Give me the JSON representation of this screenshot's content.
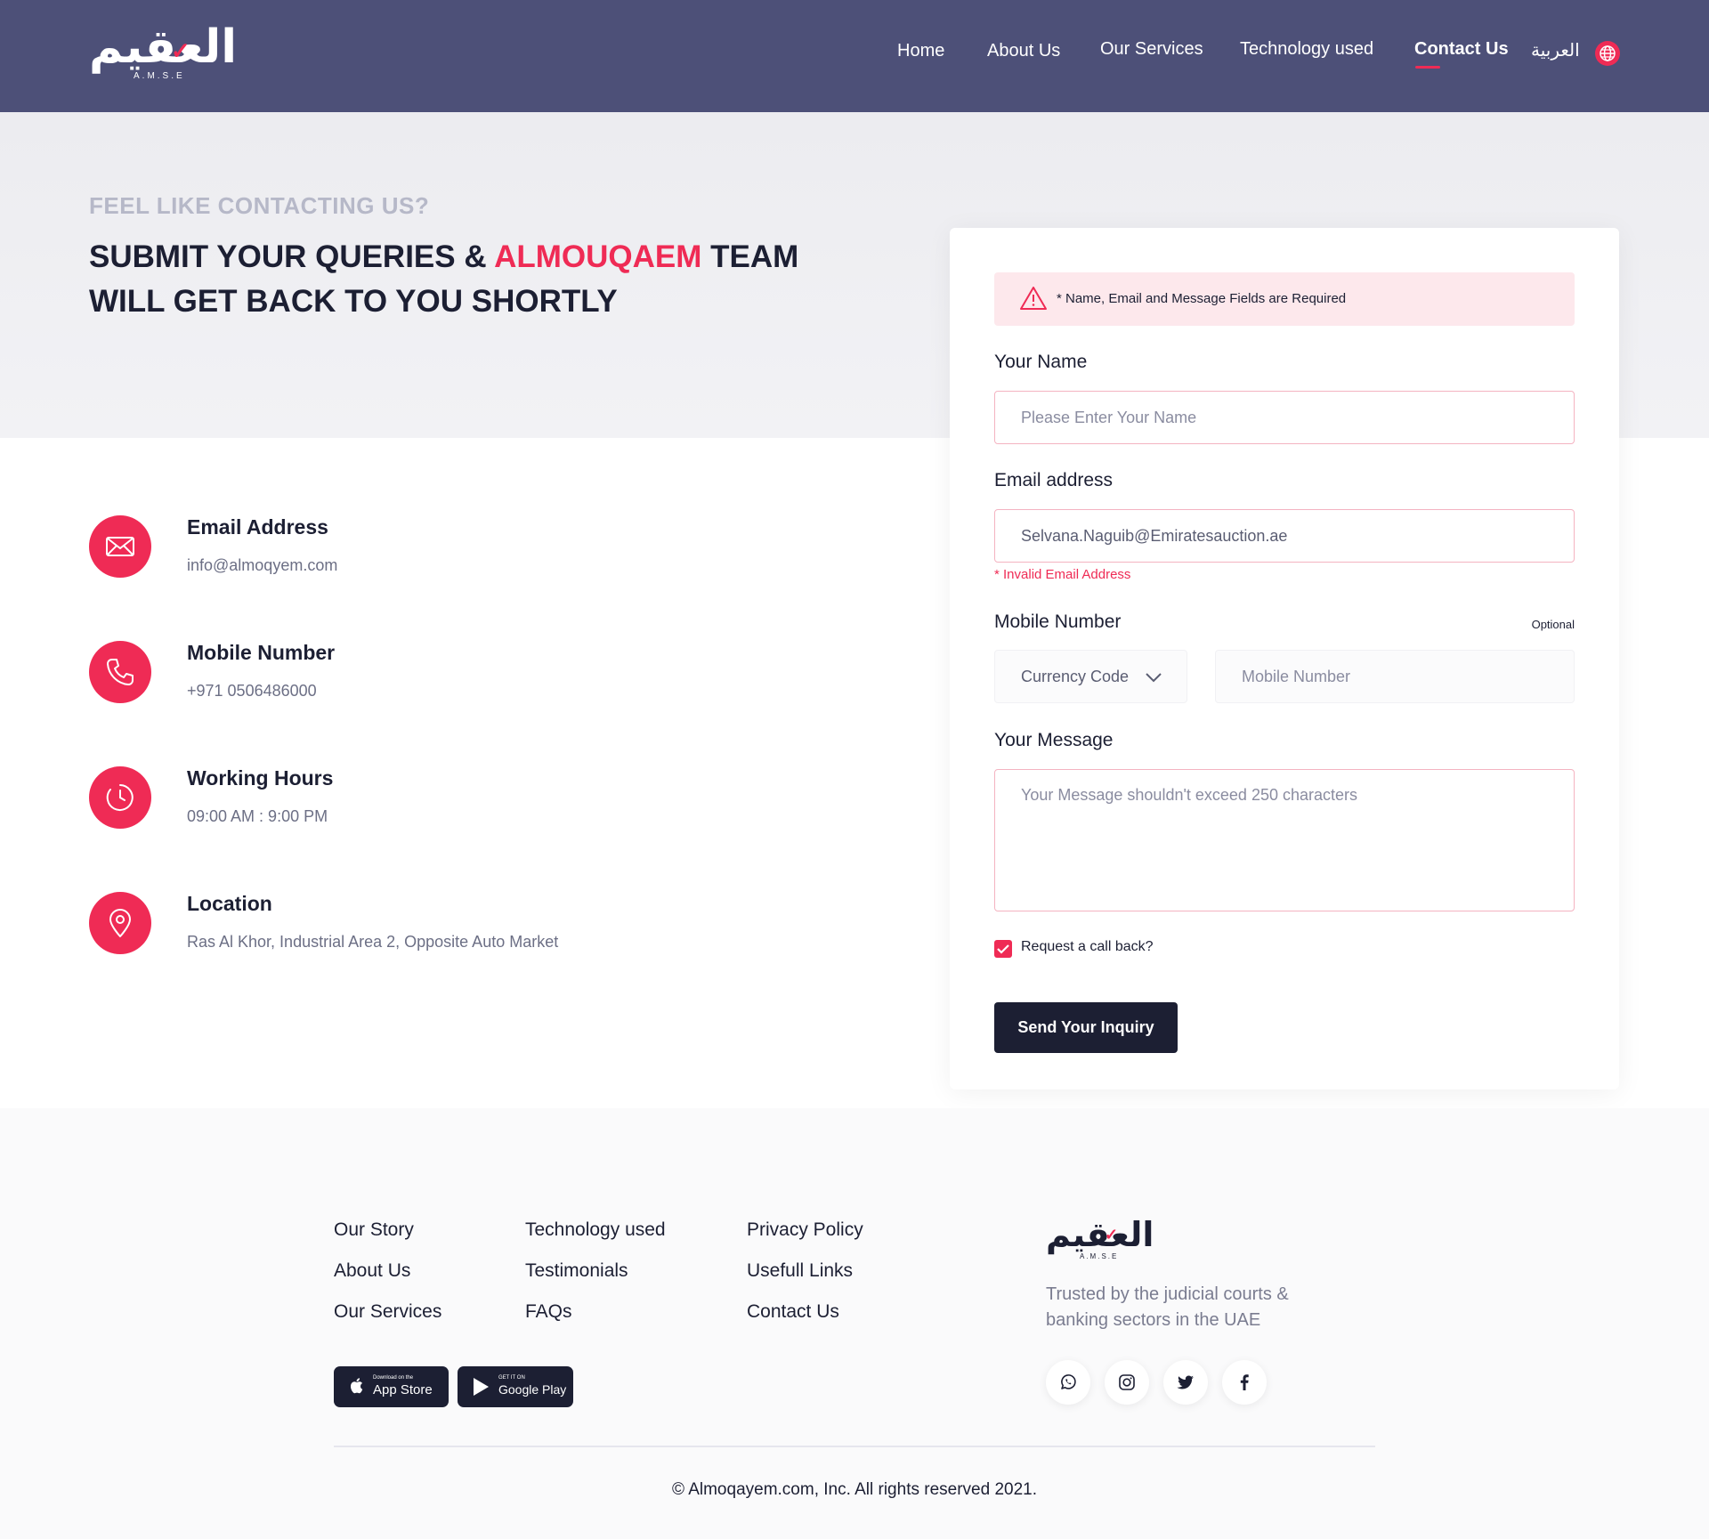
{
  "header": {
    "logo_ar": "العقيم",
    "logo_sub": "A.M.S.E",
    "nav": [
      "Home",
      "About Us",
      "Our Services",
      "Technology used",
      "Contact Us"
    ],
    "active_nav": "Contact Us",
    "language": "العربية"
  },
  "hero": {
    "eyebrow": "FEEL LIKE CONTACTING US?",
    "title_part1": "SUBMIT YOUR QUERIES & ",
    "title_accent": "ALMOUQAEM",
    "title_part2": " TEAM WILL GET BACK TO YOU SHORTLY"
  },
  "contact_info": [
    {
      "title": "Email Address",
      "value": "info@almoqyem.com",
      "icon": "envelope-icon"
    },
    {
      "title": "Mobile Number",
      "value": "+971 0506486000",
      "icon": "phone-icon"
    },
    {
      "title": "Working Hours",
      "value": "09:00 AM : 9:00 PM",
      "icon": "clock-icon"
    },
    {
      "title": "Location",
      "value": "Ras Al Khor, Industrial Area 2, Opposite Auto Market",
      "icon": "location-pin-icon"
    }
  ],
  "form": {
    "alert": "* Name, Email and Message Fields are Required",
    "name_label": "Your Name",
    "name_placeholder": "Please Enter Your Name",
    "email_label": "Email address",
    "email_value": "Selvana.Naguib@Emiratesauction.ae",
    "email_error": "* Invalid Email Address",
    "mobile_label": "Mobile Number",
    "mobile_optional": "Optional",
    "code_placeholder": "Currency Code",
    "mobile_placeholder": "Mobile Number",
    "message_label": "Your Message",
    "message_placeholder": "Your Message shouldn't exceed 250 characters",
    "callback_label": "Request a call back?",
    "callback_checked": true,
    "submit_label": "Send Your Inquiry"
  },
  "footer": {
    "links_col1": [
      "Our Story",
      "About Us",
      "Our Services"
    ],
    "links_col2": [
      "Technology used",
      "Testimonials",
      "FAQs"
    ],
    "links_col3": [
      "Privacy Policy",
      "Usefull Links",
      "Contact Us"
    ],
    "app_store_small": "Download on the",
    "app_store": "App Store",
    "google_play_small": "GET IT ON",
    "google_play": "Google Play",
    "logo_ar": "العقيم",
    "logo_sub": "A.M.S.E",
    "tagline": "Trusted by the judicial courts & banking sectors in the UAE",
    "socials": [
      "whatsapp-icon",
      "instagram-icon",
      "twitter-icon",
      "facebook-icon"
    ],
    "copyright": "© Almoqayem.com, Inc. All rights reserved 2021."
  },
  "colors": {
    "header_bg": "#4d5078",
    "accent": "#ef2b55",
    "dark": "#1c1f33"
  }
}
